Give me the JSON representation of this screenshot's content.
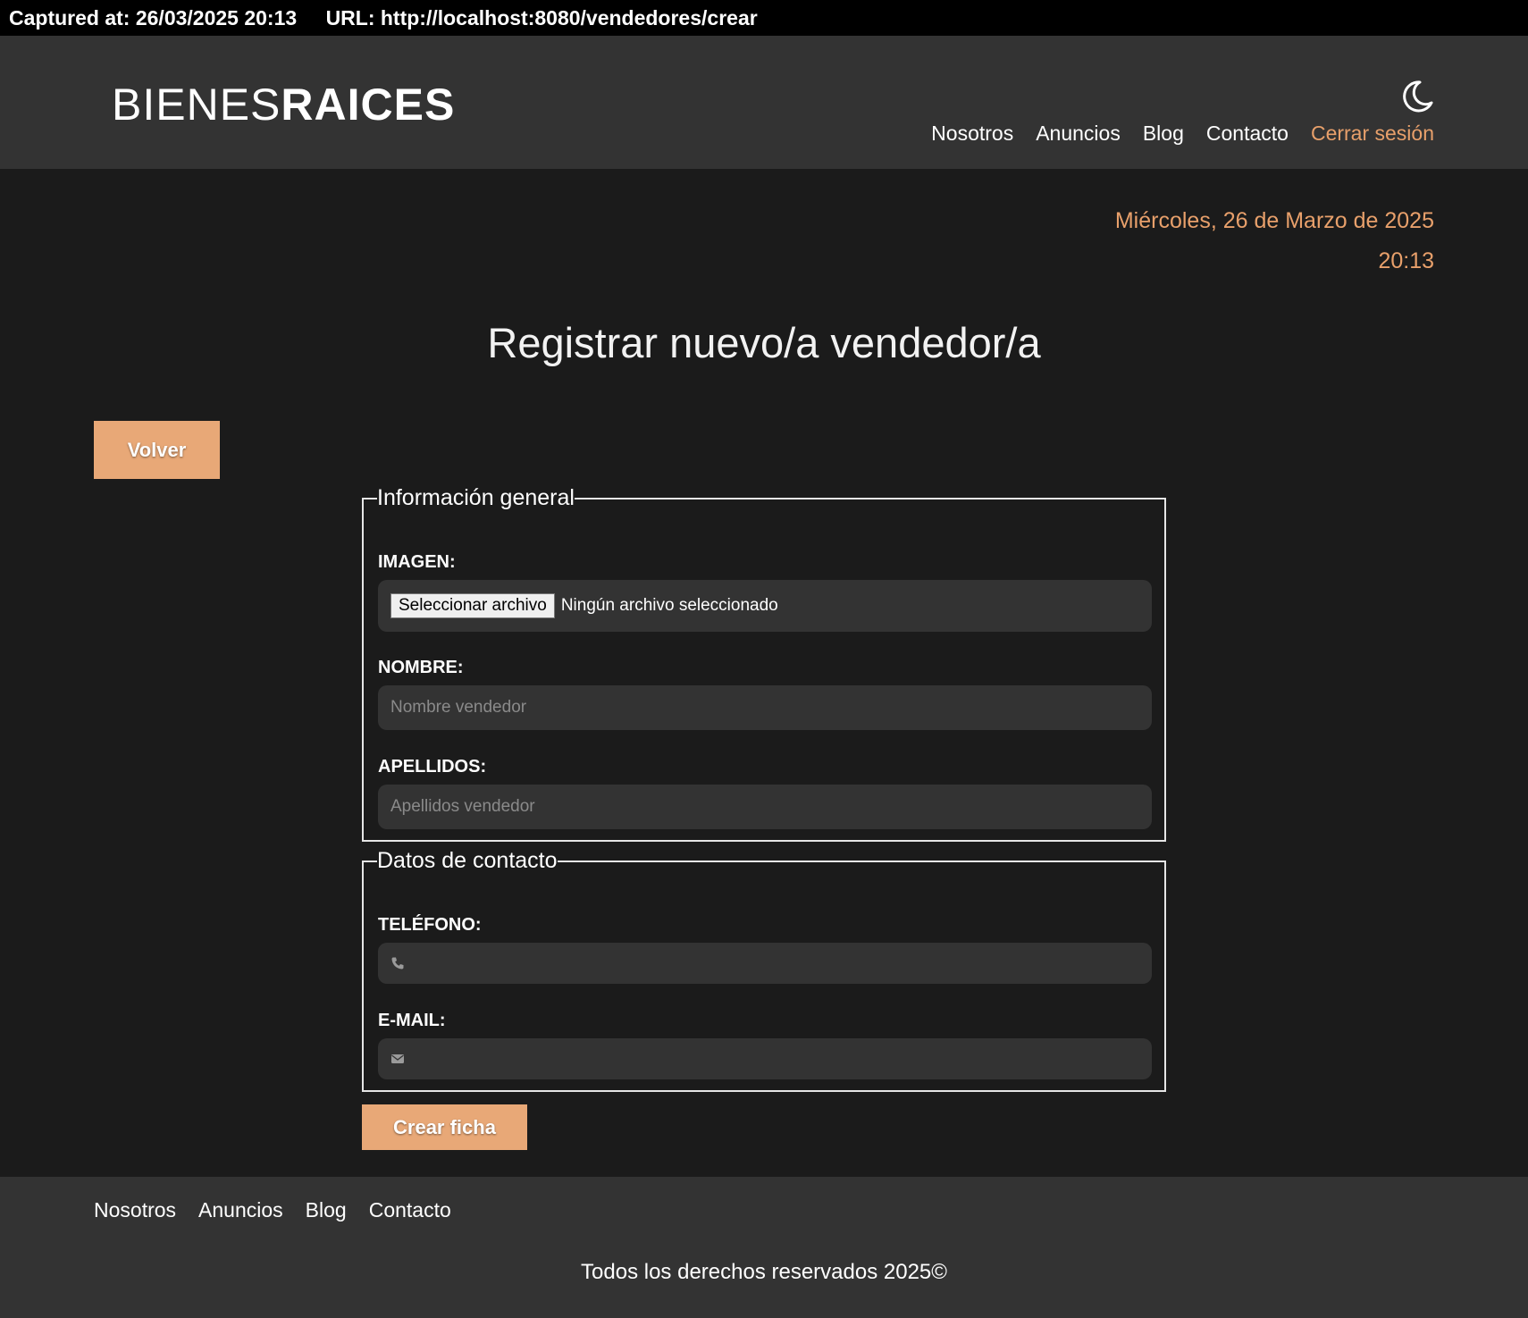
{
  "capture": {
    "captured_at": "Captured at: 26/03/2025 20:13",
    "url": "URL: http://localhost:8080/vendedores/crear"
  },
  "header": {
    "logo_light": "BIENES",
    "logo_bold": "RAICES",
    "dark_mode_icon": "moon-icon",
    "nav": {
      "nosotros": "Nosotros",
      "anuncios": "Anuncios",
      "blog": "Blog",
      "contacto": "Contacto",
      "logout": "Cerrar sesión"
    },
    "accent_color": "#e8a06b"
  },
  "date": {
    "day": "Miércoles, 26 de Marzo de 2025",
    "time": "20:13"
  },
  "main": {
    "title": "Registrar nuevo/a vendedor/a",
    "back_button": "Volver",
    "create_button": "Crear ficha",
    "button_color": "#e8a877"
  },
  "form": {
    "general": {
      "legend": "Información general",
      "image_label": "IMAGEN:",
      "file_button": "Seleccionar archivo",
      "file_status": "Ningún archivo seleccionado",
      "name_label": "NOMBRE:",
      "name_placeholder": "Nombre vendedor",
      "surname_label": "APELLIDOS:",
      "surname_placeholder": "Apellidos vendedor"
    },
    "contact": {
      "legend": "Datos de contacto",
      "phone_label": "TELÉFONO:",
      "phone_icon": "phone-icon",
      "email_label": "E-MAIL:",
      "email_icon": "envelope-icon"
    }
  },
  "footer": {
    "nav": {
      "nosotros": "Nosotros",
      "anuncios": "Anuncios",
      "blog": "Blog",
      "contacto": "Contacto"
    },
    "copyright": "Todos los derechos reservados 2025©"
  }
}
